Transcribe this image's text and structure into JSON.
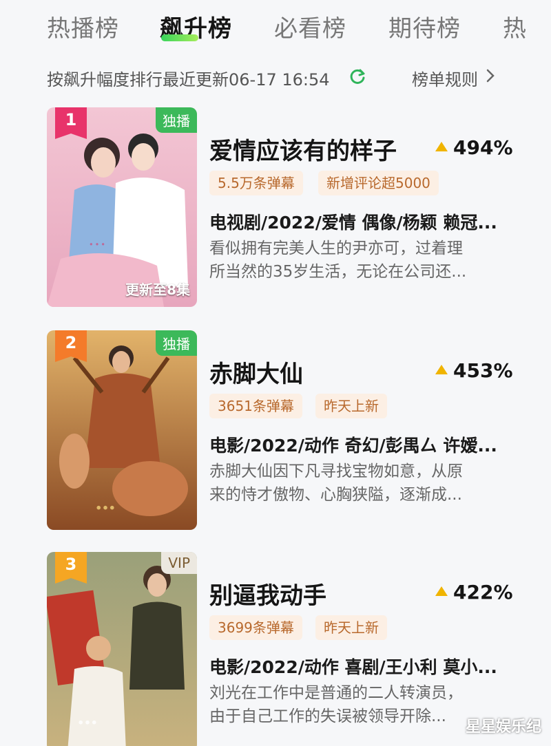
{
  "tabs": [
    {
      "label": "热播榜",
      "active": false
    },
    {
      "label": "飙升榜",
      "active": true
    },
    {
      "label": "必看榜",
      "active": false
    },
    {
      "label": "期待榜",
      "active": false
    },
    {
      "label": "热",
      "active": false
    }
  ],
  "subheader": {
    "sort_text": "按飙升幅度排行最近更新06-17 16:54",
    "rules_label": "榜单规则"
  },
  "items": [
    {
      "rank": "1",
      "badge": "独播",
      "update": "更新至8集",
      "title": "爱情应该有的样子",
      "trend": "494%",
      "tags": [
        "5.5万条弹幕",
        "新增评论超5000"
      ],
      "meta": "电视剧/2022/爱情 偶像/杨颖 赖冠...",
      "desc": [
        "看似拥有完美人生的尹亦可，过着理",
        "所当然的35岁生活，无论在公司还..."
      ]
    },
    {
      "rank": "2",
      "badge": "独播",
      "update": "",
      "title": "赤脚大仙",
      "trend": "453%",
      "tags": [
        "3651条弹幕",
        "昨天上新"
      ],
      "meta": "电影/2022/动作 奇幻/彭禺厶 许嫒...",
      "desc": [
        "赤脚大仙因下凡寻找宝物如意，从原",
        "来的恃才傲物、心胸狭隘，逐渐成..."
      ]
    },
    {
      "rank": "3",
      "badge": "VIP",
      "update": "",
      "title": "别逼我动手",
      "trend": "422%",
      "tags": [
        "3699条弹幕",
        "昨天上新"
      ],
      "meta": "电影/2022/动作 喜剧/王小利 莫小...",
      "desc": [
        "刘光在工作中是普通的二人转演员，",
        "由于自己工作的失误被领导开除..."
      ]
    }
  ],
  "watermark": "星星娱乐纪",
  "colors": {
    "accent_green": "#3cb95a",
    "tag_bg": "#fcefe4",
    "tag_text": "#b8692d",
    "trend_up": "#f0b400",
    "rank1": "#e8336a",
    "rank2": "#f47b2a",
    "rank3": "#f5a623"
  }
}
